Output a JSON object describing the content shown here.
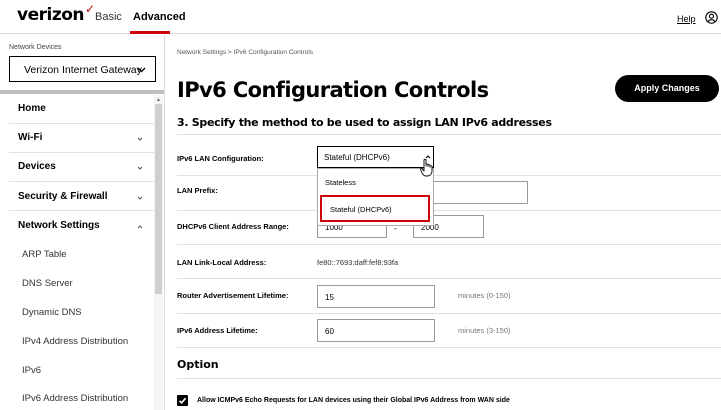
{
  "header": {
    "logo": "verizon",
    "logo_mark": "✓",
    "tabs": [
      "Basic",
      "Advanced"
    ],
    "active_tab": "Advanced",
    "help_label": "Help",
    "accent_color": "#cd040b",
    "user_icon": "user-icon"
  },
  "sidebar": {
    "devices_label": "Network Devices",
    "gateway_select": "Verizon Internet Gateway",
    "nav": [
      {
        "label": "Home"
      },
      {
        "label": "Wi-Fi",
        "chevron": "down"
      },
      {
        "label": "Devices",
        "chevron": "down"
      },
      {
        "label": "Security & Firewall",
        "chevron": "down"
      },
      {
        "label": "Network Settings",
        "chevron": "up"
      }
    ],
    "sub_items": [
      "ARP Table",
      "DNS Server",
      "Dynamic DNS",
      "IPv4 Address Distribution",
      "IPv6",
      "IPv6 Address Distribution"
    ]
  },
  "main": {
    "breadcrumb": "Network Settings  >  IPv6 Configuration Controls",
    "title": "IPv6 Configuration Controls",
    "apply_label": "Apply Changes",
    "section_title": "3. Specify the method to be used to assign LAN IPv6 addresses",
    "lan_config": {
      "label": "IPv6 LAN Configuration:",
      "selected": "Stateful (DHCPv6)",
      "options": [
        "Stateless",
        "Stateful (DHCPv6)"
      ]
    },
    "lan_prefix": {
      "label": "LAN Prefix:",
      "value": ""
    },
    "dhcp_range": {
      "label": "DHCPv6 Client Address Range:",
      "from": "1000",
      "separator": "-",
      "to": "2000"
    },
    "link_local": {
      "label": "LAN Link-Local Address:",
      "value": "fe80::7693:daff:fef8:93fa"
    },
    "router_adv": {
      "label": "Router Advertisement Lifetime:",
      "value": "15",
      "hint": "minutes (0-150)"
    },
    "addr_lifetime": {
      "label": "IPv6 Address Lifetime:",
      "value": "60",
      "hint": "minutes (3-150)"
    },
    "option_title": "Option",
    "icmp_checkbox": {
      "label": "Allow ICMPv6 Echo Requests for LAN devices using their Global IPv6 Address from WAN side",
      "checked": true
    }
  }
}
